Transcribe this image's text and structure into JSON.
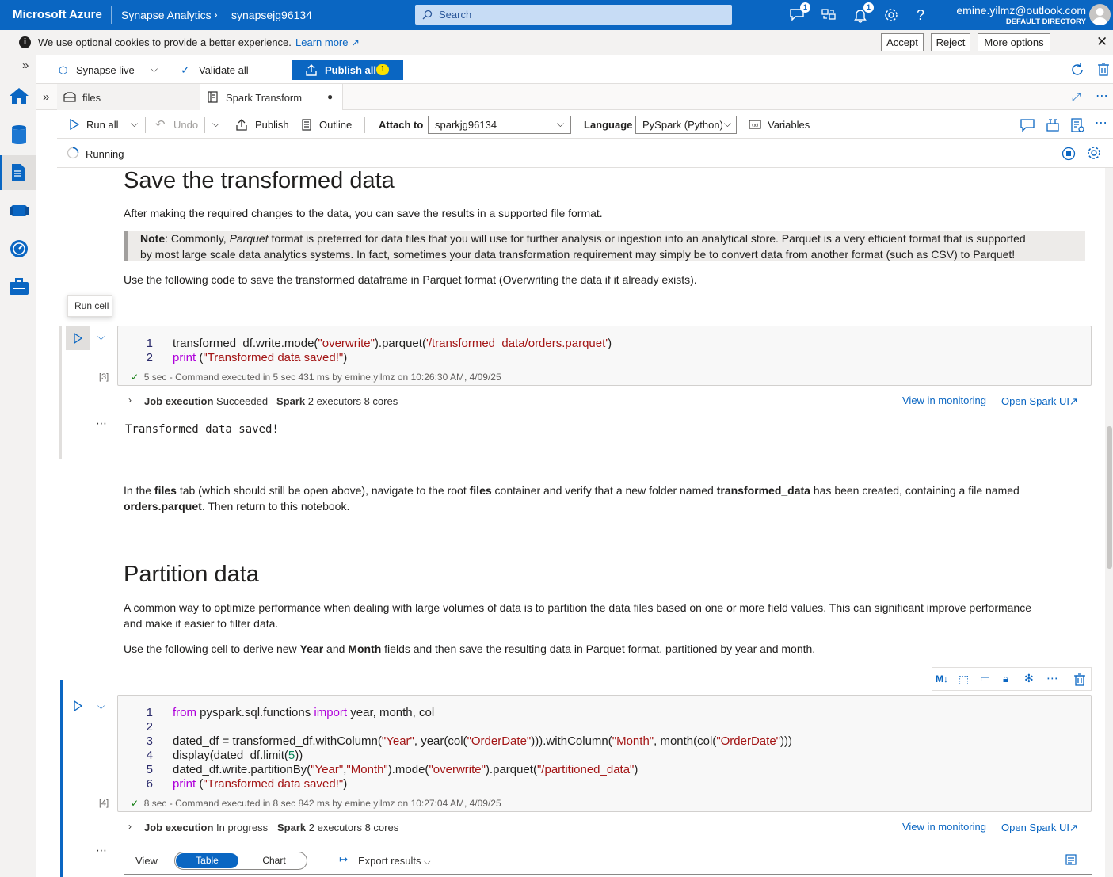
{
  "topbar": {
    "brand": "Microsoft Azure",
    "crumb1": "Synapse Analytics",
    "crumb2": "synapsejg96134",
    "search_placeholder": "Search",
    "feedback_badge": "1",
    "notifications_badge": "1",
    "user_email": "emine.yilmz@outlook.com",
    "user_directory": "DEFAULT DIRECTORY"
  },
  "cookie": {
    "message": "We use optional cookies to provide a better experience.",
    "learn_more": "Learn more",
    "accept": "Accept",
    "reject": "Reject",
    "more_options": "More options"
  },
  "toolbar1": {
    "live_mode": "Synapse live",
    "validate_all": "Validate all",
    "publish_all": "Publish all",
    "publish_count": "1"
  },
  "tabs": [
    {
      "label": "files"
    },
    {
      "label": "Spark Transform"
    }
  ],
  "toolbar2": {
    "run_all": "Run all",
    "undo": "Undo",
    "publish": "Publish",
    "outline": "Outline",
    "attach_to_label": "Attach to",
    "attach_to_value": "sparkjg96134",
    "language_label": "Language",
    "language_value": "PySpark (Python)",
    "variables": "Variables"
  },
  "status": {
    "text": "Running"
  },
  "content": {
    "h_save": "Save the transformed data",
    "p_save": "After making the required changes to the data, you can save the results in a supported file format.",
    "note_label": "Note",
    "note_pre": ": Commonly, ",
    "note_em": "Parquet",
    "note_line1_rest": " format is preferred for data files that you will use for further analysis or ingestion into an analytical store. Parquet is a very efficient format that is supported",
    "note_line2": "by most large scale data analytics systems. In fact, sometimes your data transformation requirement may simply be to convert data from another format (such as CSV) to Parquet!",
    "p_use_code": "Use the following code to save the transformed dataframe in Parquet format (Overwriting the data if it already exists).",
    "tooltip_run_cell": "Run cell",
    "cell3": {
      "exec_count": "[3]",
      "line_numbers": [
        "1",
        "2"
      ],
      "exec_time": "5 sec",
      "exec_detail": "- Command executed in 5 sec 431 ms by emine.yilmz on 10:26:30 AM, 4/09/25",
      "job_label": "Job execution",
      "job_status": "Succeeded",
      "spark_label": "Spark",
      "spark_detail": "2 executors 8 cores",
      "view_monitoring": "View in monitoring",
      "open_spark_ui": "Open Spark UI",
      "output": "Transformed data saved!"
    },
    "p_files_1": "In the ",
    "p_files_b1": "files",
    "p_files_2": " tab (which should still be open above), navigate to the root ",
    "p_files_b2": "files",
    "p_files_3": " container and verify that a new folder named ",
    "p_files_b3": "transformed_data",
    "p_files_4": " has been created, containing a file named",
    "p_files_b4": "orders.parquet",
    "p_files_5": ". Then return to this notebook.",
    "h_partition": "Partition data",
    "p_part_line1": "A common way to optimize performance when dealing with large volumes of data is to partition the data files based on one or more field values. This can significant improve performance",
    "p_part_line2": "and make it easier to filter data.",
    "p_derive_1": "Use the following cell to derive new ",
    "p_derive_b1": "Year",
    "p_derive_2": " and ",
    "p_derive_b2": "Month",
    "p_derive_3": " fields and then save the resulting data in Parquet format, partitioned by year and month.",
    "cell4": {
      "exec_count": "[4]",
      "line_numbers": [
        "1",
        "2",
        "3",
        "4",
        "5",
        "6"
      ],
      "exec_time": "8 sec",
      "exec_detail": "- Command executed in 8 sec 842 ms by emine.yilmz on 10:27:04 AM, 4/09/25",
      "job_label": "Job execution",
      "job_status": "In progress",
      "spark_label": "Spark",
      "spark_detail": "2 executors 8 cores",
      "view_monitoring": "View in monitoring",
      "open_spark_ui": "Open Spark UI",
      "view_label": "View",
      "view_table": "Table",
      "view_chart": "Chart",
      "export_results": "Export results"
    }
  },
  "colors": {
    "azure_blue": "#0a66c2",
    "badge_yellow": "#fce100"
  }
}
